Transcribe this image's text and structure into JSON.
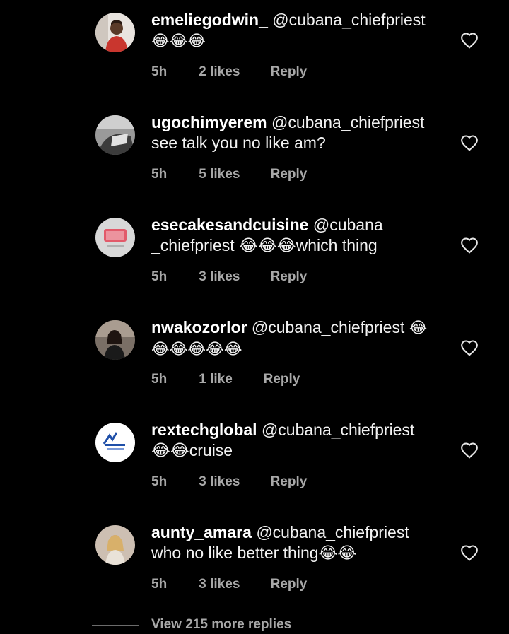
{
  "comments": [
    {
      "username": "emeliegodwin_",
      "mention": "@cubana_chiefpriest",
      "text": "😂😂😂",
      "time": "5h",
      "likes": "2 likes",
      "reply_label": "Reply",
      "avatar_icon": "man-in-red-shirt-avatar"
    },
    {
      "username": "ugochimyerem",
      "mention": "@cubana_chiefpriest",
      "text": "see talk you no like am?",
      "time": "5h",
      "likes": "5 likes",
      "reply_label": "Reply",
      "avatar_icon": "grayscale-photo-avatar"
    },
    {
      "username": "esecakesandcuisine",
      "mention": "@cubana _chiefpriest",
      "text": "😂😂😂which thing",
      "time": "5h",
      "likes": "3 likes",
      "reply_label": "Reply",
      "avatar_icon": "ese-logo-avatar"
    },
    {
      "username": "nwakozorlor",
      "mention": "@cubana_chiefpriest",
      "text": "😂😂😂😂😂😂",
      "time": "5h",
      "likes": "1 like",
      "reply_label": "Reply",
      "avatar_icon": "woman-portrait-avatar"
    },
    {
      "username": "rextechglobal",
      "mention": "@cubana_chiefpriest",
      "text": "😂😂cruise",
      "time": "5h",
      "likes": "3 likes",
      "reply_label": "Reply",
      "avatar_icon": "rextech-logo-avatar"
    },
    {
      "username": "aunty_amara",
      "mention": "@cubana_chiefpriest",
      "text": "who no like better thing😂😂",
      "time": "5h",
      "likes": "3 likes",
      "reply_label": "Reply",
      "avatar_icon": "woman-photo-avatar"
    }
  ],
  "view_more": "View 215 more replies",
  "colors": {
    "background": "#000000",
    "text": "#ffffff",
    "meta": "#a8a8a8"
  }
}
